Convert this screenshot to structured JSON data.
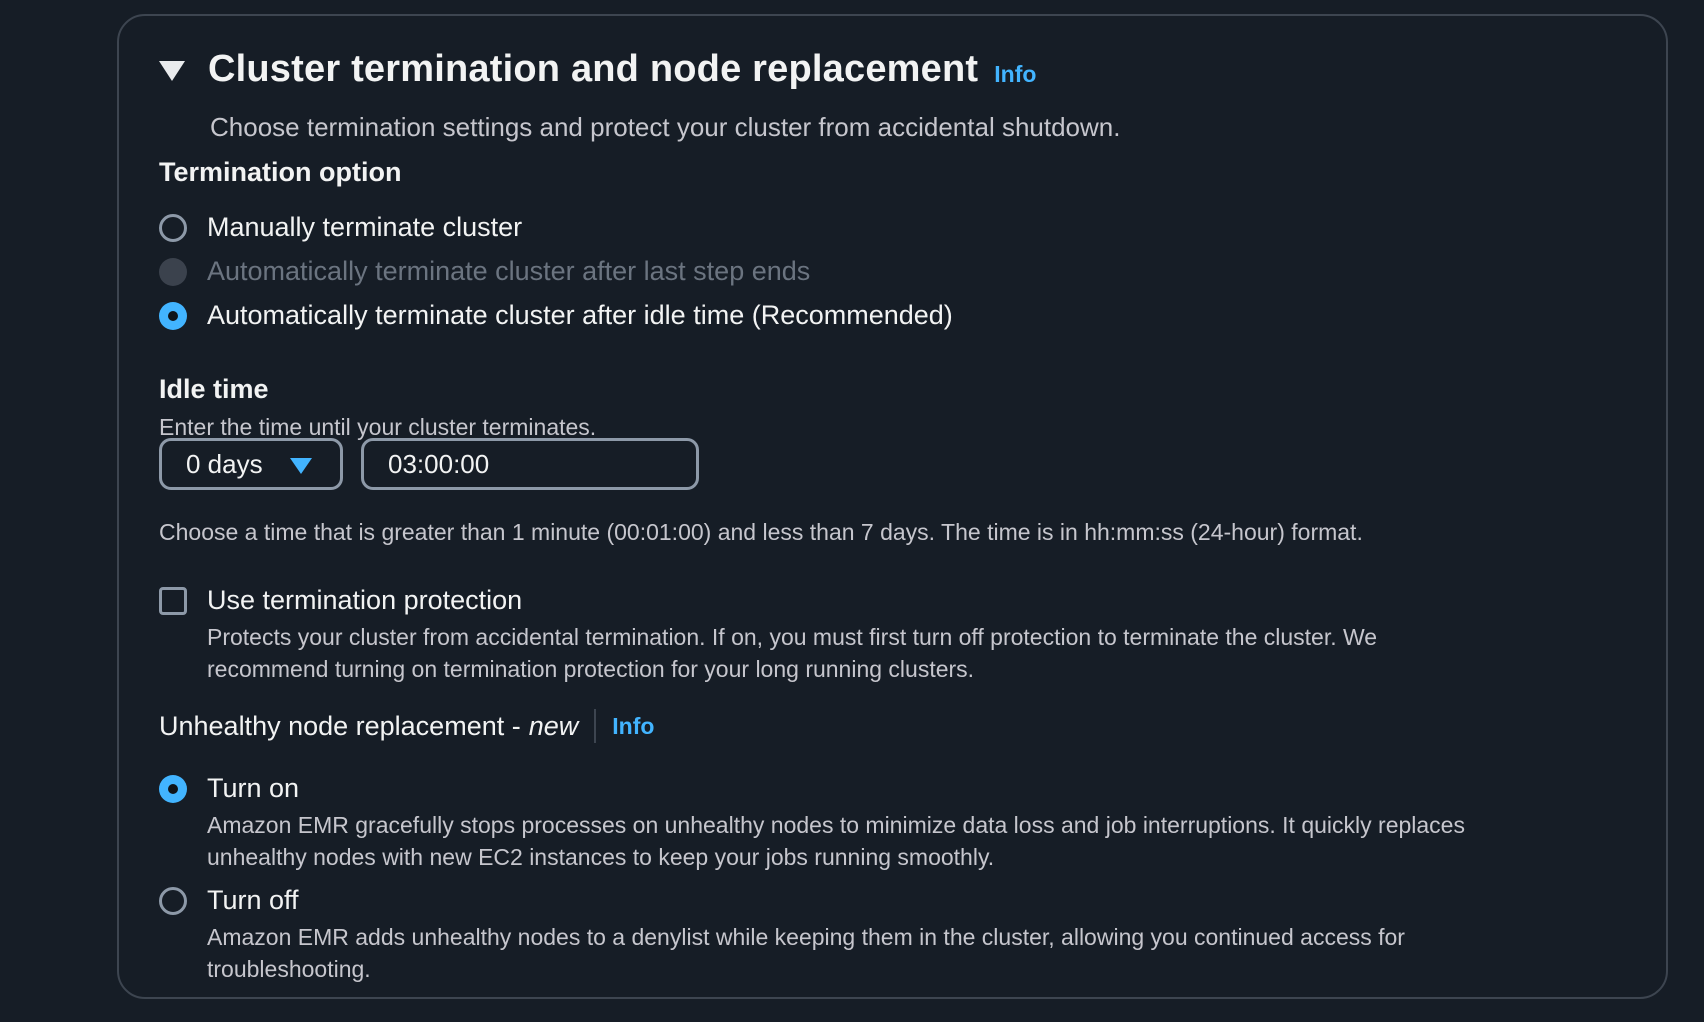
{
  "header": {
    "title": "Cluster termination and node replacement",
    "info": "Info",
    "subtitle": "Choose termination settings and protect your cluster from accidental shutdown."
  },
  "termination": {
    "label": "Termination option",
    "options": [
      {
        "label": "Manually terminate cluster",
        "state": "unselected"
      },
      {
        "label": "Automatically terminate cluster after last step ends",
        "state": "disabled"
      },
      {
        "label": "Automatically terminate cluster after idle time (Recommended)",
        "state": "selected"
      }
    ]
  },
  "idle_time": {
    "label": "Idle time",
    "description": "Enter the time until your cluster terminates.",
    "days_value": "0 days",
    "time_value": "03:00:00",
    "constraint": "Choose a time that is greater than 1 minute (00:01:00) and less than 7 days. The time is in hh:mm:ss (24-hour) format."
  },
  "protection": {
    "label": "Use termination protection",
    "checked": false,
    "description_line1": "Protects your cluster from accidental termination. If on, you must first turn off protection to terminate the cluster. We",
    "description_line2": "recommend turning on termination protection for your long running clusters."
  },
  "node_replacement": {
    "label": "Unhealthy node replacement -",
    "label_tag": "new",
    "info": "Info",
    "options": [
      {
        "label": "Turn on",
        "state": "selected",
        "desc_line1": "Amazon EMR gracefully stops processes on unhealthy nodes to minimize data loss and job interruptions. It quickly replaces",
        "desc_line2": "unhealthy nodes with new EC2 instances to keep your jobs running smoothly."
      },
      {
        "label": "Turn off",
        "state": "unselected",
        "desc_line1": "Amazon EMR adds unhealthy nodes to a denylist while keeping them in the cluster, allowing you continued access for",
        "desc_line2": "troubleshooting."
      }
    ]
  },
  "colors": {
    "background": "#161d26",
    "accent": "#42b4ff",
    "border": "#8d99a8"
  }
}
